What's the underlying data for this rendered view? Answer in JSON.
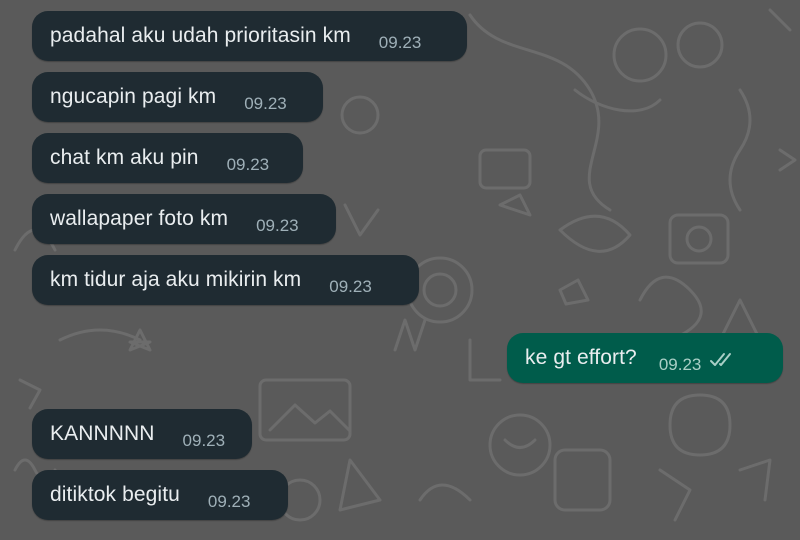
{
  "messages": [
    {
      "dir": "in",
      "text": "padahal aku udah prioritasin km",
      "time": "09.23"
    },
    {
      "dir": "in",
      "text": "ngucapin pagi km",
      "time": "09.23"
    },
    {
      "dir": "in",
      "text": "chat km aku pin",
      "time": "09.23"
    },
    {
      "dir": "in",
      "text": "wallapaper foto km",
      "time": "09.23"
    },
    {
      "dir": "in",
      "text": "km tidur aja aku mikirin km",
      "time": "09.23"
    },
    {
      "dir": "out",
      "text": "ke gt effort?",
      "time": "09.23",
      "status": "read-ticks-icon"
    },
    {
      "dir": "in",
      "text": "KANNNNN",
      "time": "09.23"
    },
    {
      "dir": "in",
      "text": "ditiktok begitu",
      "time": "09.23"
    }
  ],
  "colors": {
    "wallpaper": "#5a5a5a",
    "incoming_bubble": "#1f2b32",
    "outgoing_bubble": "#005c4b",
    "text": "#e9edef",
    "timestamp": "#9fb0b8"
  }
}
